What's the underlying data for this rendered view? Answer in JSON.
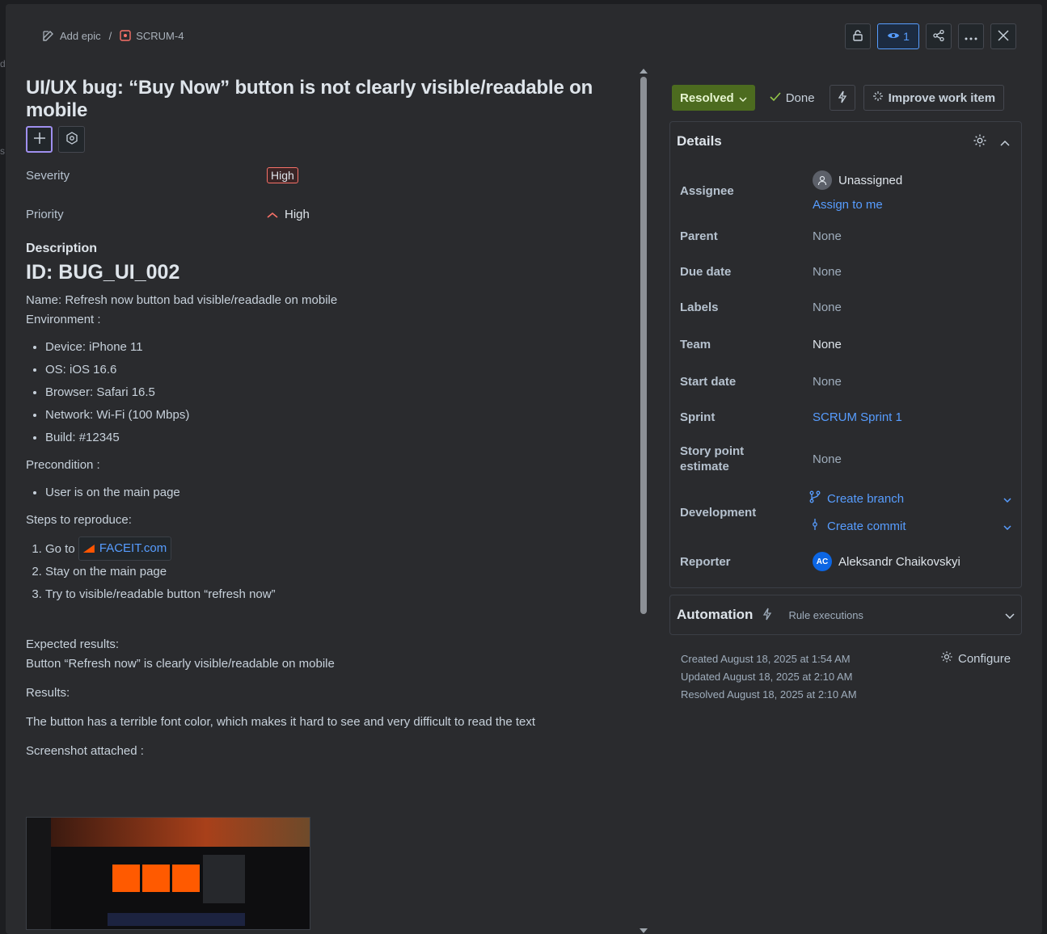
{
  "backdrop": {
    "text_a": "d",
    "text_b": "s"
  },
  "breadcrumb": {
    "add_epic": "Add epic",
    "separator": "/",
    "issue_key": "SCRUM-4"
  },
  "header": {
    "watch_count": "1"
  },
  "issue": {
    "title": "UI/UX bug: “Buy Now” button is not clearly visible/readable on mobile",
    "severity_label": "Severity",
    "severity_value": "High",
    "priority_label": "Priority",
    "priority_value": "High"
  },
  "description": {
    "heading": "Description",
    "id_heading": "ID: BUG_UI_002",
    "name_line": "Name: Refresh now button bad visible/readadle on mobile",
    "environment_label": "Environment :",
    "environment": [
      "Device: iPhone 11",
      "OS: iOS 16.6",
      "Browser: Safari 16.5",
      "Network: Wi-Fi (100 Mbps)",
      "Build: #12345"
    ],
    "precondition_label": "Precondition :",
    "preconditions": [
      "User is on the main page"
    ],
    "steps_label": "Steps to reproduce:",
    "step1_prefix": "Go to",
    "step1_link": "FACEIT.com",
    "step2": "Stay on the main page",
    "step3": "Try to visible/readable button “refresh now”",
    "expected_label": "Expected results:",
    "expected_text": "Button “Refresh now” is clearly visible/readable on mobile",
    "results_label": "Results:",
    "results_text": "The button has a terrible font color, which makes it hard to see and very difficult to read the text",
    "screenshot_label": "Screenshot attached :"
  },
  "status": {
    "resolved_label": "Resolved",
    "done_label": "Done",
    "improve_label": "Improve work item"
  },
  "details": {
    "heading": "Details",
    "assignee_label": "Assignee",
    "assignee_value": "Unassigned",
    "assign_to_me": "Assign to me",
    "parent_label": "Parent",
    "parent_value": "None",
    "due_label": "Due date",
    "due_value": "None",
    "labels_label": "Labels",
    "labels_value": "None",
    "team_label": "Team",
    "team_value": "None",
    "start_label": "Start date",
    "start_value": "None",
    "sprint_label": "Sprint",
    "sprint_value": "SCRUM Sprint 1",
    "story_label_1": "Story point",
    "story_label_2": "estimate",
    "story_value": "None",
    "dev_label": "Development",
    "create_branch": "Create branch",
    "create_commit": "Create commit",
    "reporter_label": "Reporter",
    "reporter_initials": "AC",
    "reporter_name": "Aleksandr Chaikovskyi"
  },
  "automation": {
    "heading": "Automation",
    "rule_executions": "Rule executions"
  },
  "meta": {
    "created": "Created August 18, 2025 at 1:54 AM",
    "updated": "Updated August 18, 2025 at 2:10 AM",
    "resolved": "Resolved August 18, 2025 at 2:10 AM",
    "configure": "Configure"
  },
  "colors": {
    "accent": "#579dff",
    "resolved_bg": "#4c6b1f",
    "focus": "#9f8fef",
    "severity": "#f87168"
  }
}
